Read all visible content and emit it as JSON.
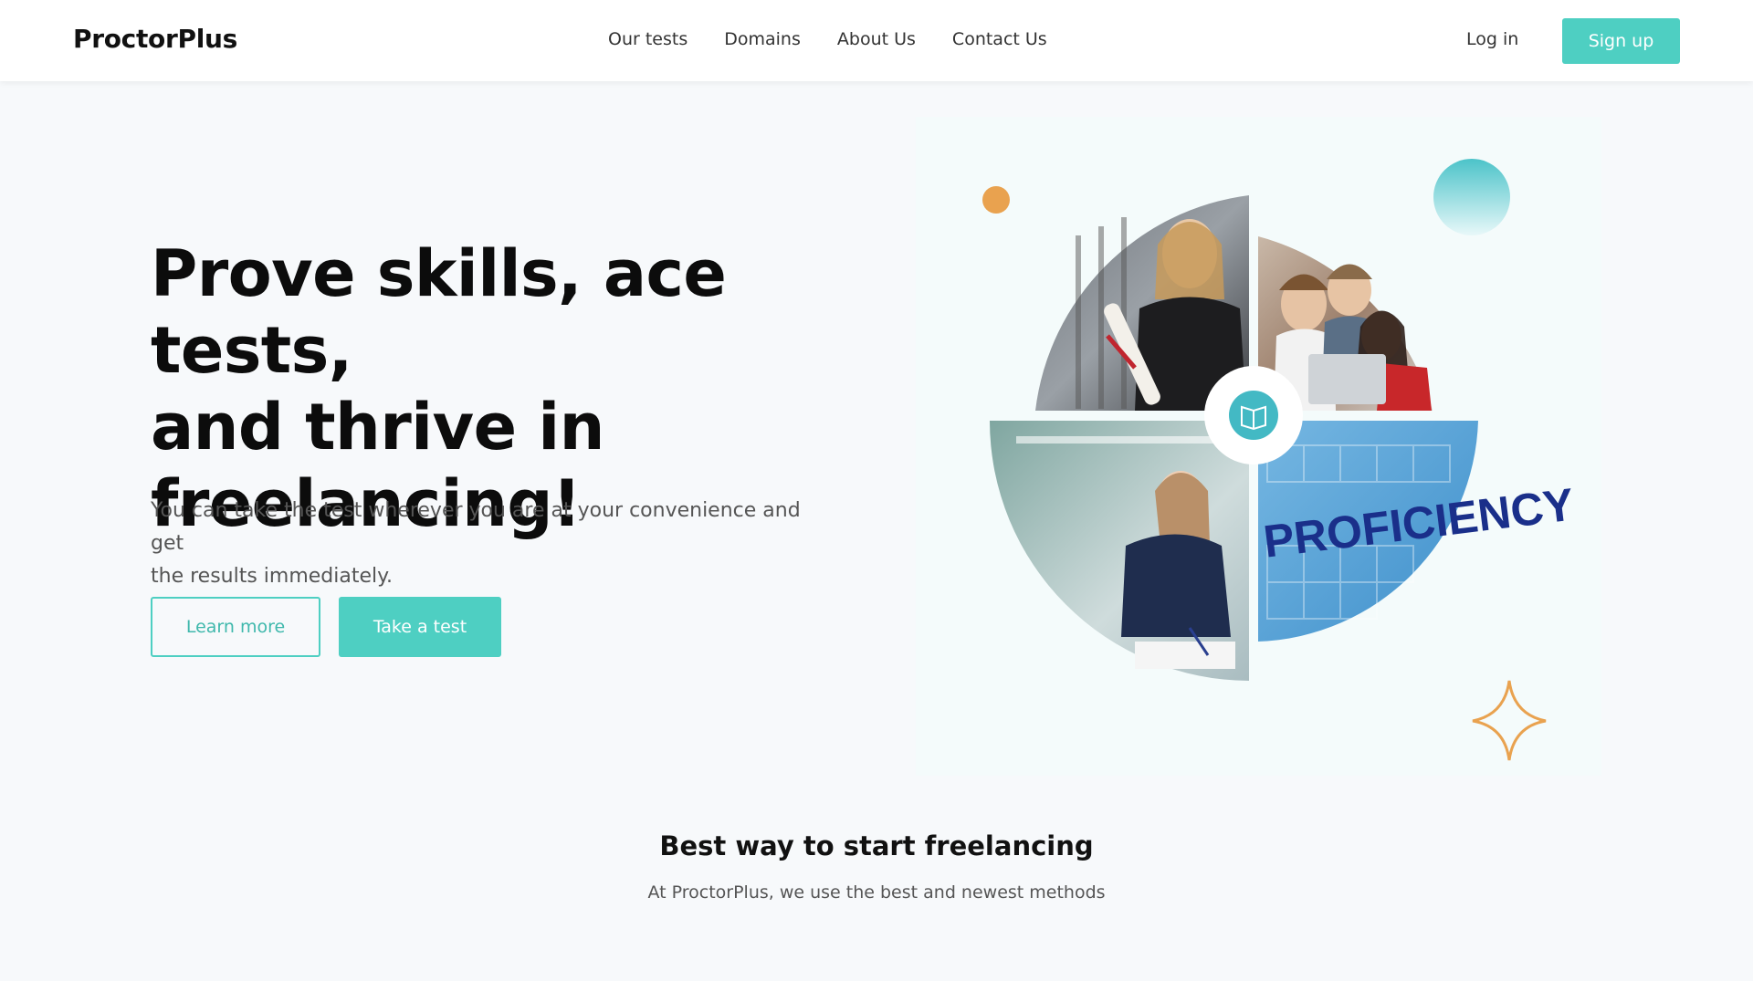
{
  "header": {
    "logo": "ProctorPlus",
    "nav": [
      "Our tests",
      "Domains",
      "About Us",
      "Contact Us"
    ],
    "login_label": "Log in",
    "signup_label": "Sign up"
  },
  "hero": {
    "title_lines": [
      "Prove skills, ace tests,",
      "and thrive in",
      "freelancing!"
    ],
    "subtitle_lines": [
      "You can take the test wherever you are at your convenience and get",
      "the results immediately."
    ],
    "learn_more_label": "Learn more",
    "take_test_label": "Take a test",
    "illustration": {
      "badge_word": "PROFICIENCY",
      "center_icon": "open-book-icon"
    }
  },
  "section": {
    "title": "Best way to start freelancing",
    "subtitle": "At ProctorPlus, we use the best and newest methods"
  },
  "colors": {
    "accent": "#4ecfc2",
    "accent_text": "#3fb8ac",
    "orange": "#e9a24f",
    "background": "#f7f9fb"
  }
}
